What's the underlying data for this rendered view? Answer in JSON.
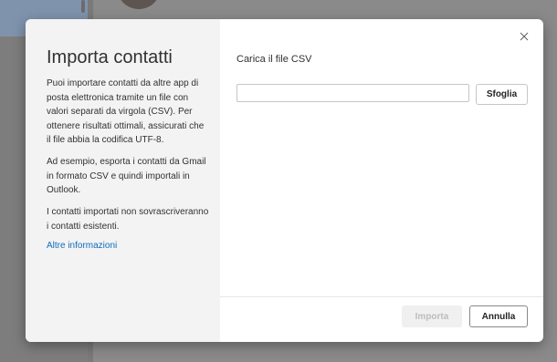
{
  "dialog": {
    "title": "Importa contatti",
    "info": {
      "paragraph_1": "Puoi importare contatti da altre app di posta elettronica tramite un file con valori separati da virgola (CSV). Per ottenere risultati ottimali, assicurati che il file abbia la codifica UTF-8.",
      "paragraph_2": "Ad esempio, esporta i contatti da Gmail in formato CSV e quindi importali in Outlook.",
      "paragraph_3": "I contatti importati non sovrascriveranno i contatti esistenti.",
      "more_info_link": "Altre informazioni"
    },
    "upload": {
      "label": "Carica il file CSV",
      "file_value": "",
      "browse_label": "Sfoglia"
    },
    "footer": {
      "import_label": "Importa",
      "import_enabled": false,
      "cancel_label": "Annulla"
    },
    "close_icon": "close-icon"
  },
  "colors": {
    "link": "#0f6cbd",
    "info_panel_bg": "#f3f3f3",
    "overlay": "#8a8a8a",
    "disabled_text": "#bdbdbd"
  }
}
